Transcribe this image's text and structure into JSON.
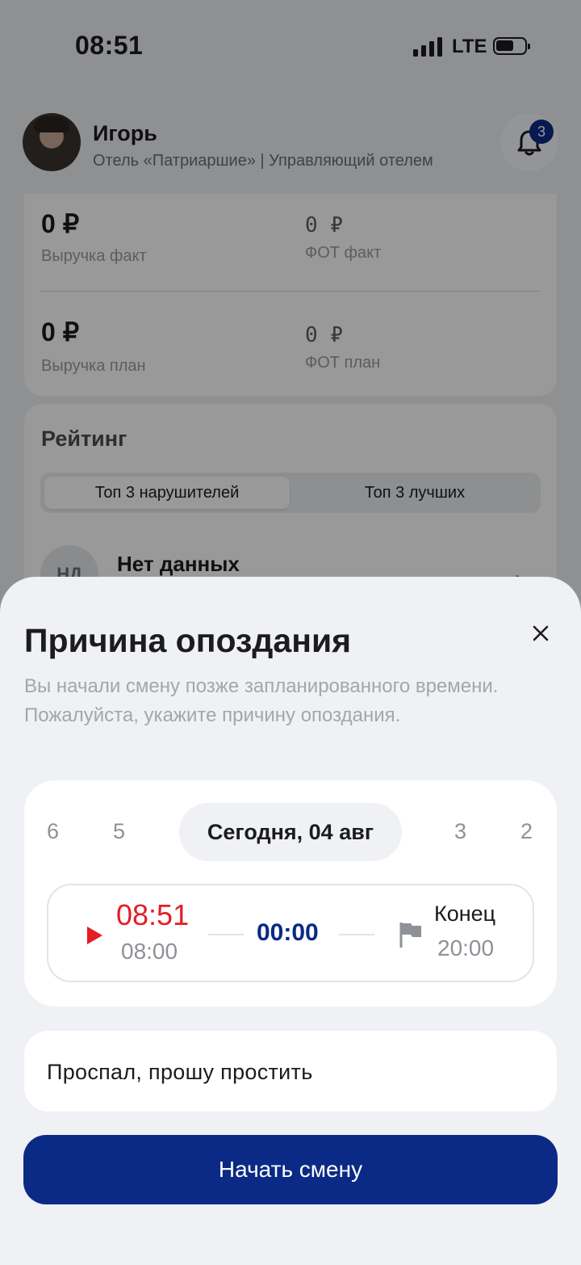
{
  "status_bar": {
    "time": "08:51",
    "network": "LTE"
  },
  "header": {
    "name": "Игорь",
    "role": "Отель «Патриаршие» | Управляющий отелем",
    "notifications_count": "3"
  },
  "stats": {
    "revenue_fact_value": "0 ₽",
    "revenue_fact_label": "Выручка факт",
    "fot_fact_value": "0 ₽",
    "fot_fact_label": "ФОТ факт",
    "revenue_plan_value": "0 ₽",
    "revenue_plan_label": "Выручка план",
    "fot_plan_value": "0 ₽",
    "fot_plan_label": "ФОТ план"
  },
  "rating": {
    "title": "Рейтинг",
    "tab_active": "Топ 3 нарушителей",
    "tab_inactive": "Топ 3 лучших",
    "row_initials": "НД",
    "row_title": "Нет данных"
  },
  "sheet": {
    "title": "Причина опоздания",
    "description_line1": "Вы начали смену позже запланированного времени.",
    "description_line2": "Пожалуйста, укажите причину опоздания.",
    "days": [
      "6",
      "5",
      "Сегодня, 04 авг",
      "3",
      "2"
    ],
    "start_actual": "08:51",
    "start_plan": "08:00",
    "duration": "00:00",
    "end_label": "Конец",
    "end_time": "20:00",
    "reason_text": "Проспал, прошу простить",
    "submit_label": "Начать смену"
  },
  "colors": {
    "accent": "#0b2a86",
    "late": "#e31e24",
    "overlay": "rgba(0,0,0,0.4)"
  }
}
